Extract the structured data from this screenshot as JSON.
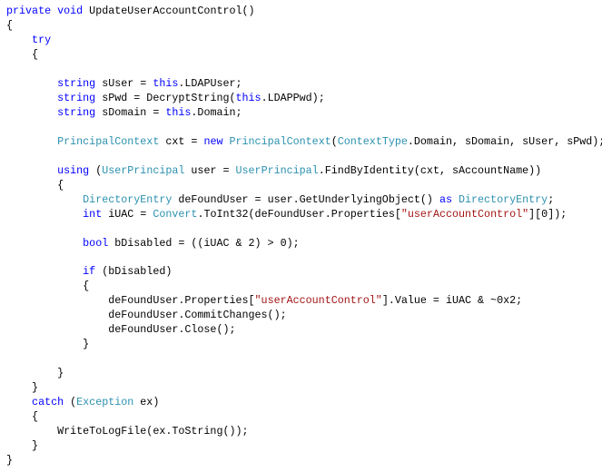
{
  "editor": {
    "colors": {
      "keyword": "#0000ff",
      "type": "#2b91af",
      "string": "#a31515",
      "plain": "#000000"
    },
    "lines": [
      [
        [
          "k",
          "private void"
        ],
        [
          "p",
          " UpdateUserAccountControl()"
        ]
      ],
      [
        [
          "p",
          "{"
        ]
      ],
      [
        [
          "k",
          "    try"
        ]
      ],
      [
        [
          "p",
          "    {"
        ]
      ],
      [],
      [
        [
          "k",
          "        string"
        ],
        [
          "p",
          " sUser = "
        ],
        [
          "k",
          "this"
        ],
        [
          "p",
          ".LDAPUser;"
        ]
      ],
      [
        [
          "k",
          "        string"
        ],
        [
          "p",
          " sPwd = DecryptString("
        ],
        [
          "k",
          "this"
        ],
        [
          "p",
          ".LDAPPwd);"
        ]
      ],
      [
        [
          "k",
          "        string"
        ],
        [
          "p",
          " sDomain = "
        ],
        [
          "k",
          "this"
        ],
        [
          "p",
          ".Domain;"
        ]
      ],
      [],
      [
        [
          "t",
          "        PrincipalContext"
        ],
        [
          "p",
          " cxt = "
        ],
        [
          "k",
          "new"
        ],
        [
          "p",
          " "
        ],
        [
          "t",
          "PrincipalContext"
        ],
        [
          "p",
          "("
        ],
        [
          "t",
          "ContextType"
        ],
        [
          "p",
          ".Domain, sDomain, sUser, sPwd);"
        ]
      ],
      [],
      [
        [
          "k",
          "        using"
        ],
        [
          "p",
          " ("
        ],
        [
          "t",
          "UserPrincipal"
        ],
        [
          "p",
          " user = "
        ],
        [
          "t",
          "UserPrincipal"
        ],
        [
          "p",
          ".FindByIdentity(cxt, sAccountName))"
        ]
      ],
      [
        [
          "p",
          "        {"
        ]
      ],
      [
        [
          "t",
          "            DirectoryEntry"
        ],
        [
          "p",
          " deFoundUser = user.GetUnderlyingObject() "
        ],
        [
          "k",
          "as"
        ],
        [
          "p",
          " "
        ],
        [
          "t",
          "DirectoryEntry"
        ],
        [
          "p",
          ";"
        ]
      ],
      [
        [
          "k",
          "            int"
        ],
        [
          "p",
          " iUAC = "
        ],
        [
          "t",
          "Convert"
        ],
        [
          "p",
          ".ToInt32(deFoundUser.Properties["
        ],
        [
          "s",
          "\"userAccountControl\""
        ],
        [
          "p",
          "][0]);"
        ]
      ],
      [],
      [
        [
          "k",
          "            bool"
        ],
        [
          "p",
          " bDisabled = ((iUAC & 2) > 0);"
        ]
      ],
      [],
      [
        [
          "k",
          "            if"
        ],
        [
          "p",
          " (bDisabled)"
        ]
      ],
      [
        [
          "p",
          "            {"
        ]
      ],
      [
        [
          "p",
          "                deFoundUser.Properties["
        ],
        [
          "s",
          "\"userAccountControl\""
        ],
        [
          "p",
          "].Value = iUAC & ~0x2;"
        ]
      ],
      [
        [
          "p",
          "                deFoundUser.CommitChanges();"
        ]
      ],
      [
        [
          "p",
          "                deFoundUser.Close();"
        ]
      ],
      [
        [
          "p",
          "            }"
        ]
      ],
      [],
      [
        [
          "p",
          "        }"
        ]
      ],
      [
        [
          "p",
          "    }"
        ]
      ],
      [
        [
          "k",
          "    catch"
        ],
        [
          "p",
          " ("
        ],
        [
          "t",
          "Exception"
        ],
        [
          "p",
          " ex)"
        ]
      ],
      [
        [
          "p",
          "    {"
        ]
      ],
      [
        [
          "p",
          "        WriteToLogFile(ex.ToString());"
        ]
      ],
      [
        [
          "p",
          "    }"
        ]
      ],
      [
        [
          "p",
          "}"
        ]
      ]
    ]
  }
}
